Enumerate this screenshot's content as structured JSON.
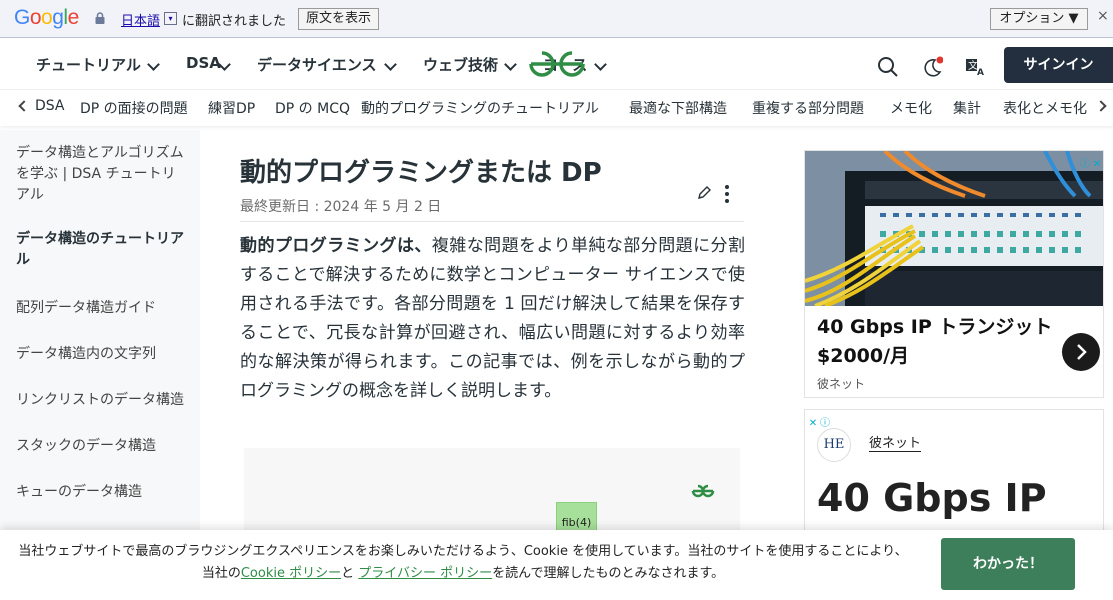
{
  "translate_bar": {
    "logo": "Google",
    "language": "日本語",
    "message": "に翻訳されました",
    "show_original": "原文を表示",
    "options": "オプション ▼",
    "close": "×",
    "logo_colors": [
      "#4285f4",
      "#ea4335",
      "#fbbc05",
      "#4285f4",
      "#34a853",
      "#ea4335"
    ]
  },
  "nav": {
    "items": [
      "チュートリアル",
      "DSA",
      "データサイエンス",
      "ウェブ技術",
      "コース"
    ],
    "signin": "サインイン",
    "brand_color": "#2f8d46"
  },
  "topics": [
    "DSA",
    "DP の面接の問題",
    "練習DP",
    "DP の MCQ",
    "動的プログラミングのチュートリアル",
    "最適な下部構造",
    "重複する部分問題",
    "メモ化",
    "集計",
    "表化とメモ化"
  ],
  "sidebar": {
    "items": [
      "データ構造とアルゴリズムを学ぶ | DSA チュートリアル",
      "データ構造のチュートリアル",
      "配列データ構造ガイド",
      "データ構造内の文字列",
      "リンクリストのデータ構造",
      "スタックのデータ構造",
      "キューのデータ構造"
    ]
  },
  "article": {
    "title": "動的プログラミングまたは DP",
    "updated": "最終更新日 : 2024 年 5 月 2 日",
    "lead_bold": "動的プログラミングは、",
    "body": "複雑な問題をより単純な部分問題に分割することで解決するために数学とコンピューター サイエンスで使用される手法です。各部分問題を 1 回だけ解決して結果を保存することで、冗長な計算が回避され、幅広い問題に対するより効率的な解決策が得られます。この記事では、例を示しながら動的プログラミングの概念を詳しく説明します。",
    "figure_label": "fib(4)"
  },
  "ads": {
    "ad1": {
      "headline": "40 Gbps IP トランジット $2000/月",
      "source": "彼ネット"
    },
    "ad2": {
      "logo_text": "HE",
      "source": "彼ネット",
      "headline": "40 Gbps IP"
    }
  },
  "cookie": {
    "text_1": "当社ウェブサイトで最高のブラウジングエクスペリエンスをお楽しみいただけるよう、Cookie を使用しています。当社のサイトを使用することにより、当社の",
    "link_cookie": "Cookie ポリシー",
    "text_2": "と",
    "link_privacy": "プライバシー ポリシー",
    "text_3": "を読んで理解したものとみなされます。",
    "button": "わかった！"
  }
}
